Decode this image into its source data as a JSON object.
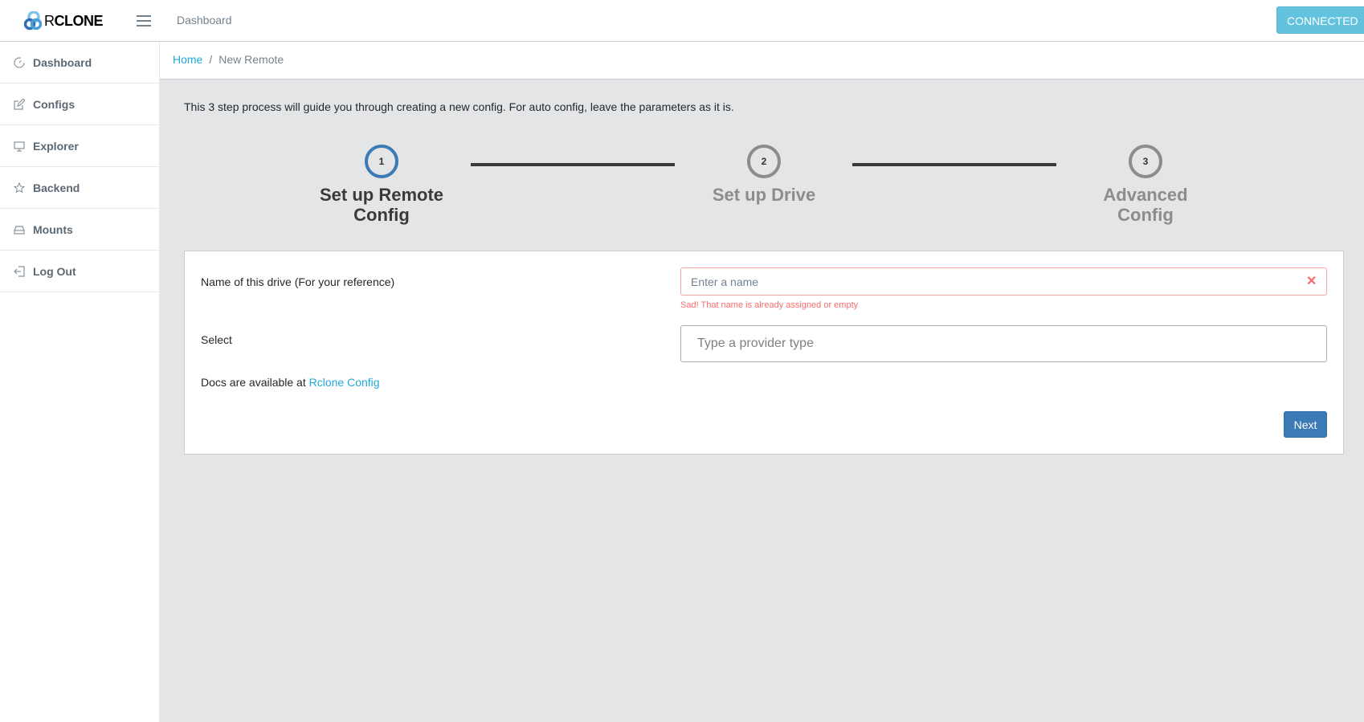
{
  "header": {
    "logo_prefix": "R",
    "logo_bold": "CLONE",
    "nav_link": "Dashboard",
    "status_button": "CONNECTED",
    "status_color": "#63c2de"
  },
  "sidebar": {
    "items": [
      {
        "label": "Dashboard",
        "icon": "speedometer-icon"
      },
      {
        "label": "Configs",
        "icon": "pencil-square-icon"
      },
      {
        "label": "Explorer",
        "icon": "monitor-icon"
      },
      {
        "label": "Backend",
        "icon": "star-icon"
      },
      {
        "label": "Mounts",
        "icon": "drive-icon"
      },
      {
        "label": "Log Out",
        "icon": "logout-icon"
      }
    ]
  },
  "breadcrumb": {
    "home": "Home",
    "separator": "/",
    "current": "New Remote"
  },
  "main": {
    "intro": "This 3 step process will guide you through creating a new config. For auto config, leave the parameters as it is.",
    "steps": [
      {
        "number": "1",
        "label": "Set up Remote Config",
        "active": true
      },
      {
        "number": "2",
        "label": "Set up Drive",
        "active": false
      },
      {
        "number": "3",
        "label": "Advanced Config",
        "active": false
      }
    ],
    "form": {
      "name_label": "Name of this drive (For your reference)",
      "name_value": "",
      "name_placeholder": "Enter a name",
      "name_error": "Sad! That name is already assigned or empty",
      "select_label": "Select",
      "provider_value": "",
      "provider_placeholder": "Type a provider type",
      "docs_text": "Docs are available at ",
      "docs_link": "Rclone Config",
      "next_button": "Next"
    }
  },
  "colors": {
    "accent": "#3c7ab5",
    "link": "#20a8d8",
    "error": "#f86c6b",
    "background": "#e4e5e6"
  }
}
